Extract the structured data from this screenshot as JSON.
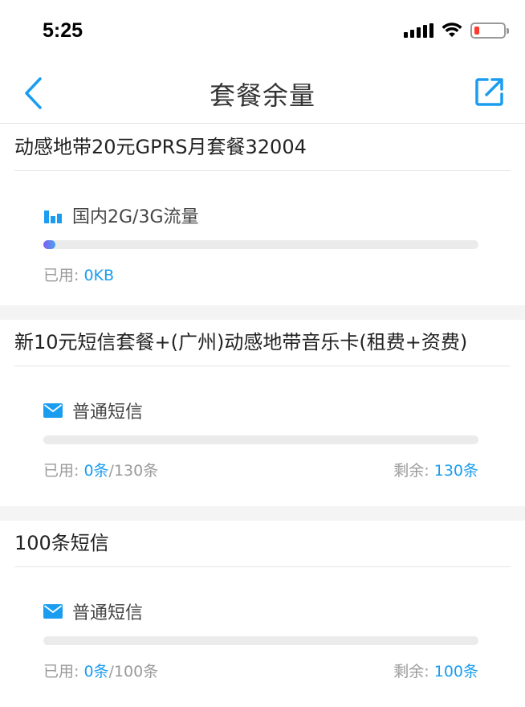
{
  "status_bar": {
    "time": "5:25",
    "battery_color": "#ff3b30"
  },
  "nav": {
    "title": "套餐余量",
    "accent_color": "#1a9df0"
  },
  "packages": [
    {
      "title": "动感地带20元GPRS月套餐32004",
      "usage_icon": "bar-chart-icon",
      "usage_name": "国内2G/3G流量",
      "progress_fraction": 0.02,
      "used_label": "已用: ",
      "used_value": "0KB",
      "used_total": "",
      "remain_label": "",
      "remain_value": ""
    },
    {
      "title": "新10元短信套餐+(广州)动感地带音乐卡(租费+资费)",
      "usage_icon": "envelope-icon",
      "usage_name": "普通短信",
      "progress_fraction": 0,
      "used_label": "已用: ",
      "used_value": "0条",
      "used_total": "/130条",
      "remain_label": "剩余: ",
      "remain_value": "130条"
    },
    {
      "title": "100条短信",
      "usage_icon": "envelope-icon",
      "usage_name": "普通短信",
      "progress_fraction": 0,
      "used_label": "已用: ",
      "used_value": "0条",
      "used_total": "/100条",
      "remain_label": "剩余: ",
      "remain_value": "100条"
    }
  ]
}
